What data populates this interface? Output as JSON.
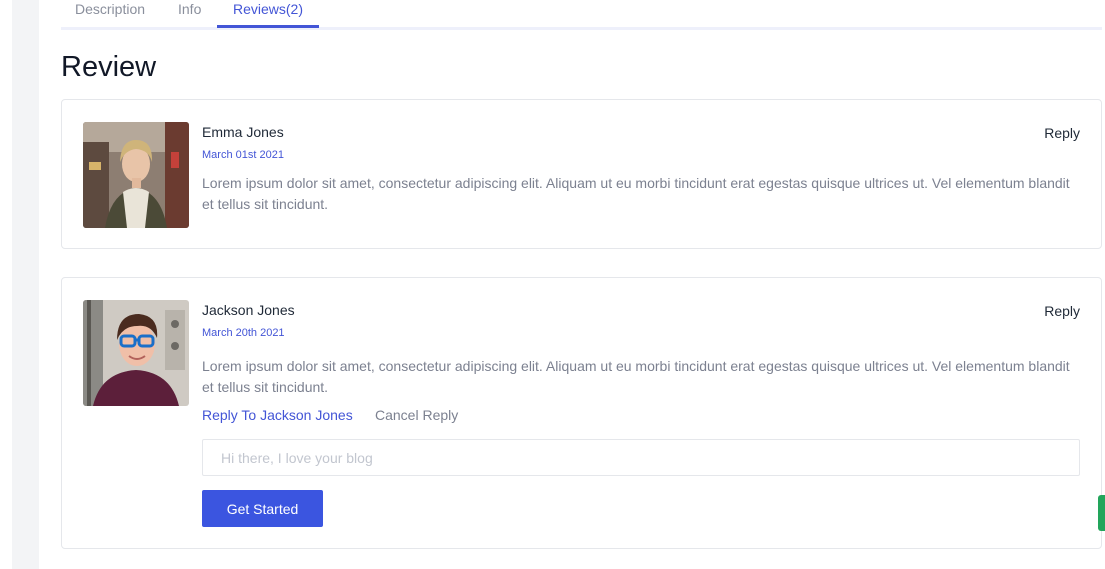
{
  "tabs": [
    {
      "label": "Description"
    },
    {
      "label": "Info"
    },
    {
      "label": "Reviews(2)",
      "active": true
    }
  ],
  "page_title": "Review",
  "reviews": [
    {
      "name": "Emma Jones",
      "date": "March 01st 2021",
      "text": "Lorem ipsum dolor sit amet, consectetur adipiscing elit. Aliquam ut eu morbi tincidunt erat egestas quisque ultrices ut. Vel elementum blandit et tellus sit tincidunt.",
      "reply_label": "Reply"
    },
    {
      "name": "Jackson Jones",
      "date": "March 20th 2021",
      "text": "Lorem ipsum dolor sit amet, consectetur adipiscing elit. Aliquam ut eu morbi tincidunt erat egestas quisque ultrices ut. Vel elementum blandit et tellus sit tincidunt.",
      "reply_label": "Reply"
    }
  ],
  "reply_form": {
    "reply_to_label": "Reply To Jackson Jones",
    "cancel_label": "Cancel Reply",
    "placeholder": "Hi there, I love your blog",
    "value": "",
    "submit_label": "Get Started"
  },
  "colors": {
    "accent": "#4355d6",
    "button": "#3b55e0",
    "side_tab": "#22a55b"
  }
}
